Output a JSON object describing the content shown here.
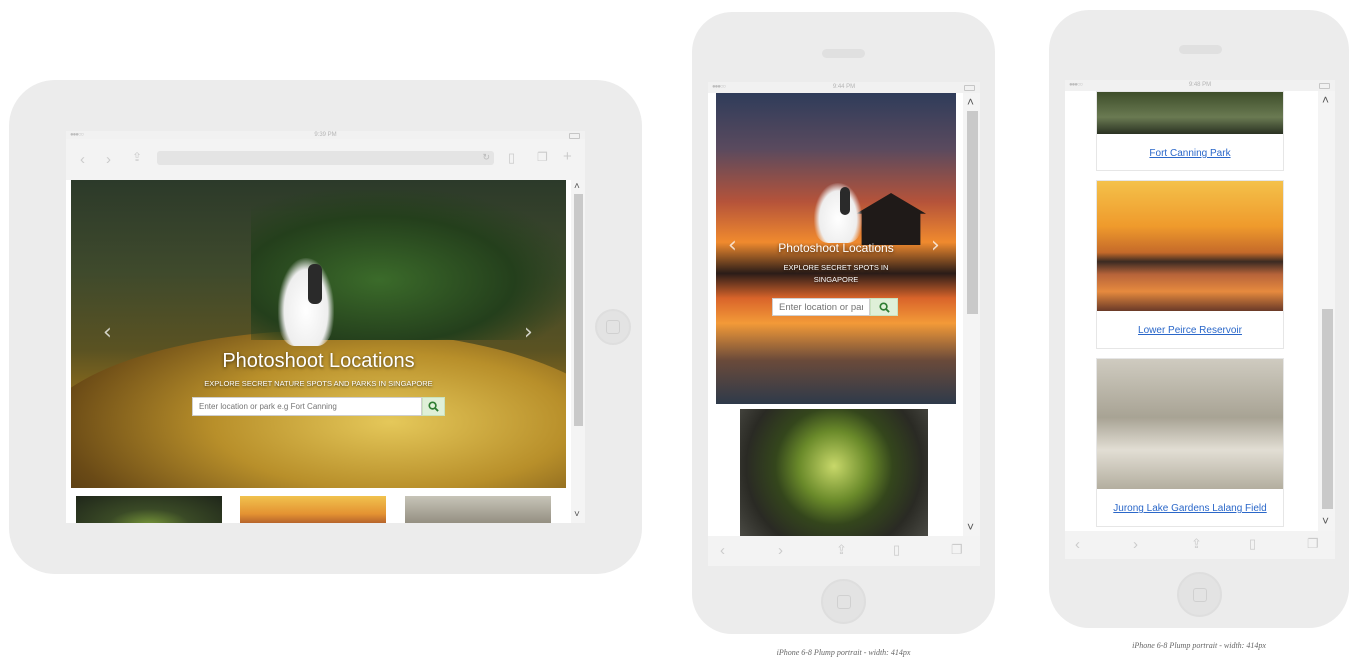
{
  "tablet": {
    "status_time": "9:39 PM",
    "hero": {
      "title": "Photoshoot Locations",
      "subtitle": "EXPLORE SECRET NATURE SPOTS AND PARKS IN SINGAPORE",
      "search_placeholder": "Enter location or park e.g Fort Canning"
    }
  },
  "phone1": {
    "status_time": "9:44 PM",
    "hero": {
      "title": "Photoshoot Locations",
      "subtitle_line1": "EXPLORE SECRET SPOTS IN",
      "subtitle_line2": "SINGAPORE",
      "search_placeholder": "Enter location or park e.g Fort Canning"
    },
    "caption": "iPhone 6-8 Plump portrait - width: 414px"
  },
  "phone2": {
    "status_time": "9:48 PM",
    "cards": [
      {
        "label": "Fort Canning Park"
      },
      {
        "label": "Lower Peirce Reservoir"
      },
      {
        "label": "Jurong Lake Gardens Lalang Field"
      }
    ],
    "caption": "iPhone 6-8 Plump portrait - width: 414px"
  },
  "colors": {
    "link": "#2a67c9",
    "search_button": "#dff0d8",
    "frame": "#ececec"
  }
}
